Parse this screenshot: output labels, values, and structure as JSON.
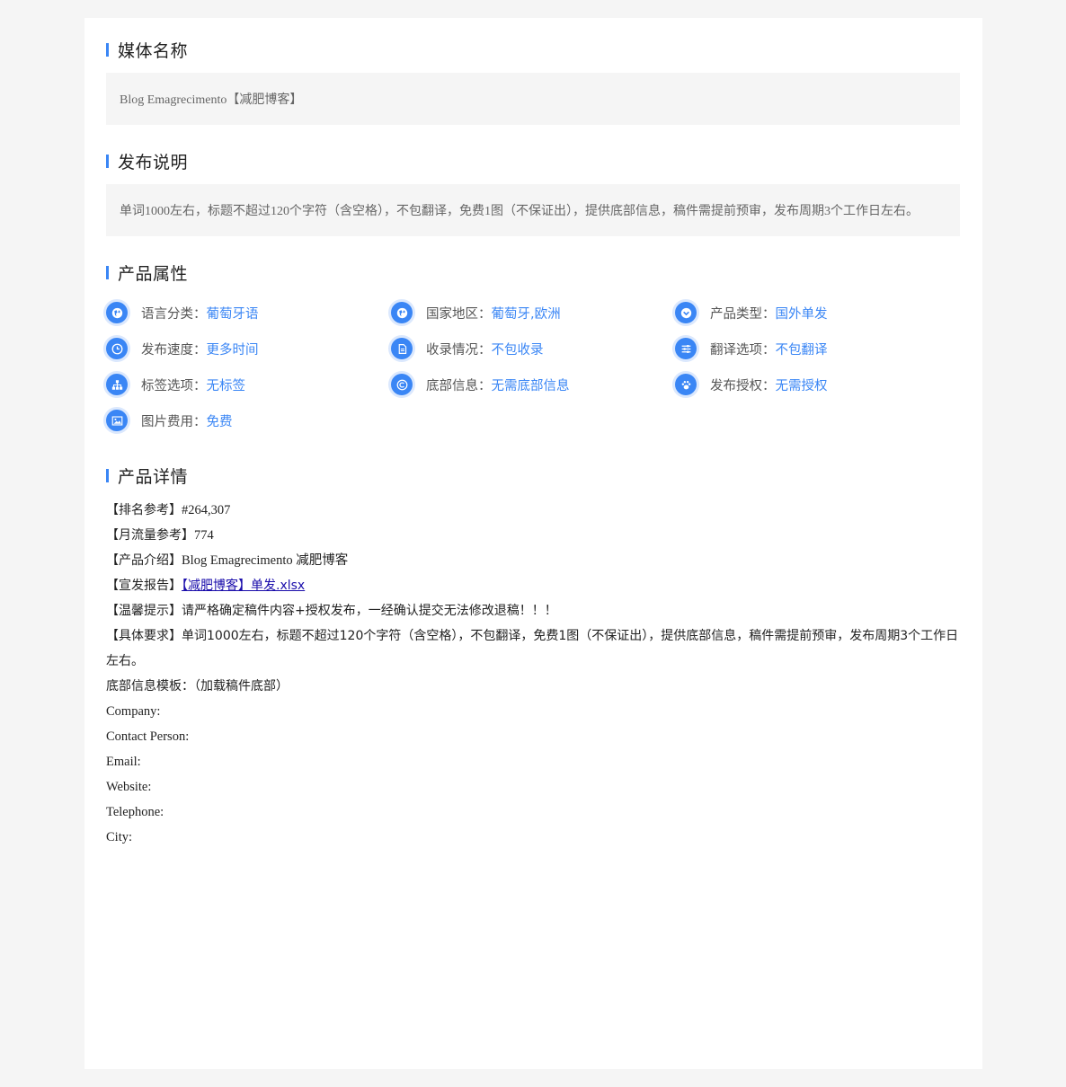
{
  "media_name": {
    "title": "媒体名称",
    "value": "Blog Emagrecimento【减肥博客】"
  },
  "publish_notes": {
    "title": "发布说明",
    "value": "单词1000左右，标题不超过120个字符（含空格），不包翻译，免费1图（不保证出），提供底部信息，稿件需提前预审，发布周期3个工作日左右。"
  },
  "attributes": {
    "title": "产品属性",
    "items": [
      {
        "label": "语言分类：",
        "value": "葡萄牙语",
        "icon": "globe-icon"
      },
      {
        "label": "国家地区：",
        "value": "葡萄牙,欧洲",
        "icon": "globe-icon"
      },
      {
        "label": "产品类型：",
        "value": "国外单发",
        "icon": "chevron-down-icon"
      },
      {
        "label": "发布速度：",
        "value": "更多时间",
        "icon": "clock-icon"
      },
      {
        "label": "收录情况：",
        "value": "不包收录",
        "icon": "document-icon"
      },
      {
        "label": "翻译选项：",
        "value": "不包翻译",
        "icon": "sliders-icon"
      },
      {
        "label": "标签选项：",
        "value": "无标签",
        "icon": "sitemap-icon"
      },
      {
        "label": "底部信息：",
        "value": "无需底部信息",
        "icon": "copyright-icon"
      },
      {
        "label": "发布授权：",
        "value": "无需授权",
        "icon": "paw-icon"
      },
      {
        "label": "图片费用：",
        "value": "免费",
        "icon": "image-icon"
      }
    ]
  },
  "details": {
    "title": "产品详情",
    "rank_key": "【排名参考】",
    "rank_value": "#264,307",
    "traffic_key": "【月流量参考】",
    "traffic_value": "774",
    "intro_key": "【产品介绍】",
    "intro_value": "Blog Emagrecimento 减肥博客",
    "report_key": "【宣发报告】",
    "report_link": "【减肥博客】单发.xlsx",
    "tip_key": "【温馨提示】",
    "tip_value": "请严格确定稿件内容+授权发布，一经确认提交无法修改退稿！！！",
    "req_key": "【具体要求】",
    "req_value": "单词1000左右，标题不超过120个字符（含空格），不包翻译，免费1图（不保证出），提供底部信息，稿件需提前预审，发布周期3个工作日左右。",
    "footer_template": "底部信息模板：（加载稿件底部）",
    "fields": [
      "Company:",
      "Contact Person:",
      "Email:",
      "Website:",
      "Telephone:",
      "City:"
    ]
  }
}
